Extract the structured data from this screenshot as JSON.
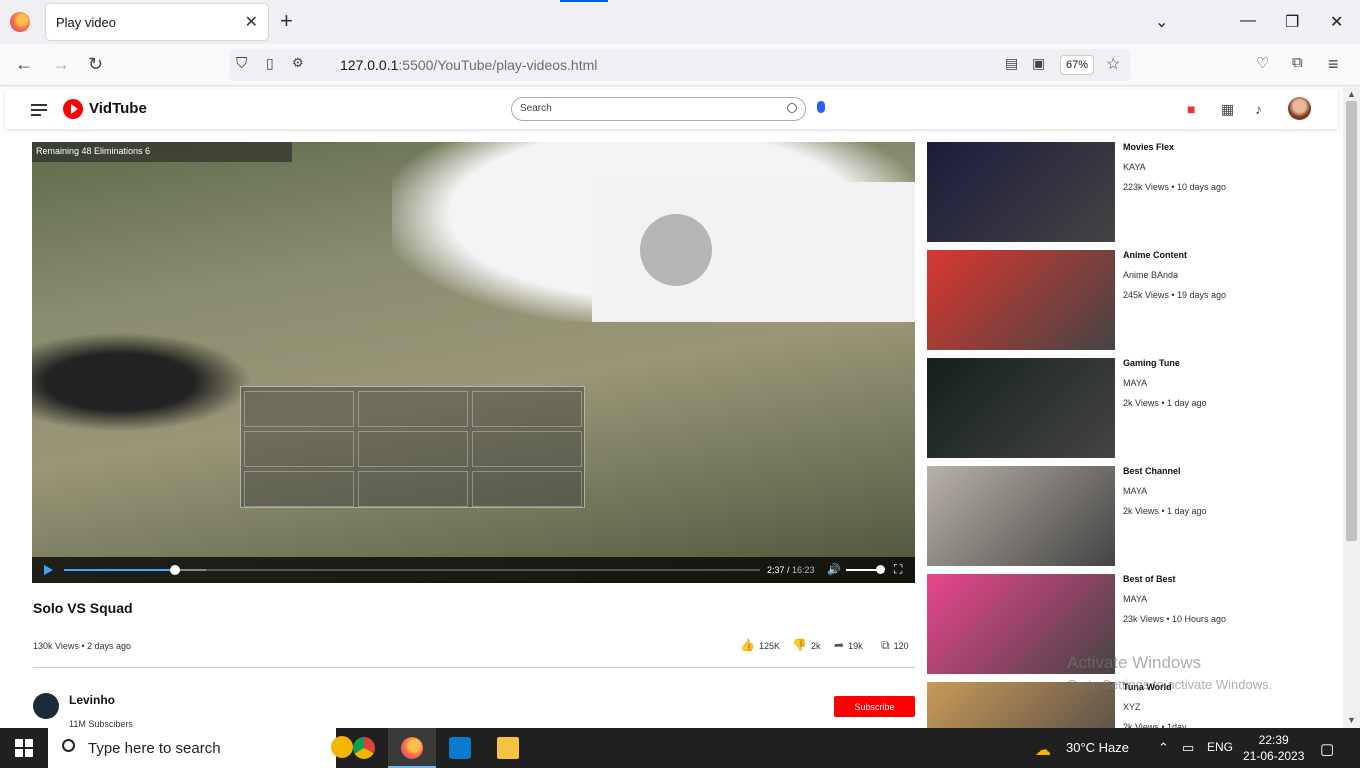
{
  "browser": {
    "tab_title": "Play video",
    "tab_close": "✕",
    "new_tab": "+",
    "url_host": "127.0.0.1",
    "url_path": ":5500/YouTube/play-videos.html",
    "zoom": "67%"
  },
  "header": {
    "logo_text": "VidTube",
    "search_placeholder": "Search"
  },
  "video": {
    "hud_text": "Remaining 48   Eliminations 6",
    "current_time": "2:37",
    "duration": "16:23",
    "progress_fraction": 0.16,
    "volume_fraction": 1.0
  },
  "info": {
    "title": "Solo VS Squad",
    "meta": "130k Views • 2 days ago",
    "likes": "125K",
    "dislikes": "2k",
    "shares": "19k",
    "saves": "120"
  },
  "channel": {
    "name": "Levinho",
    "subscribers": "11M Subscibers",
    "subscribe_label": "Subscribe"
  },
  "recommendations": [
    {
      "title": "Movies Flex",
      "channel": "KAYA",
      "meta": "223k Views • 10 days ago",
      "thumb_color": "#1b1b3a"
    },
    {
      "title": "Anime Content",
      "channel": "Anime BAnda",
      "meta": "245k Views • 19 days ago",
      "thumb_color": "#d8382e"
    },
    {
      "title": "Gaming Tune",
      "channel": "MAYA",
      "meta": "2k Views • 1 day ago",
      "thumb_color": "#14201a"
    },
    {
      "title": "Best Channel",
      "channel": "MAYA",
      "meta": "2k Views • 1 day ago",
      "thumb_color": "#b9b2a8"
    },
    {
      "title": "Best of Best",
      "channel": "MAYA",
      "meta": "23k Views • 10 Hours ago",
      "thumb_color": "#e9458c"
    },
    {
      "title": "Tuna World",
      "channel": "XYZ",
      "meta": "2k Views • 1day",
      "thumb_color": "#c99a58"
    }
  ],
  "watermark": {
    "line1": "Activate Windows",
    "line2": "Go to Settings to activate Windows."
  },
  "taskbar": {
    "search_text": "Type here to search",
    "weather": "30°C  Haze",
    "lang": "ENG",
    "time": "22:39",
    "date": "21-06-2023"
  }
}
